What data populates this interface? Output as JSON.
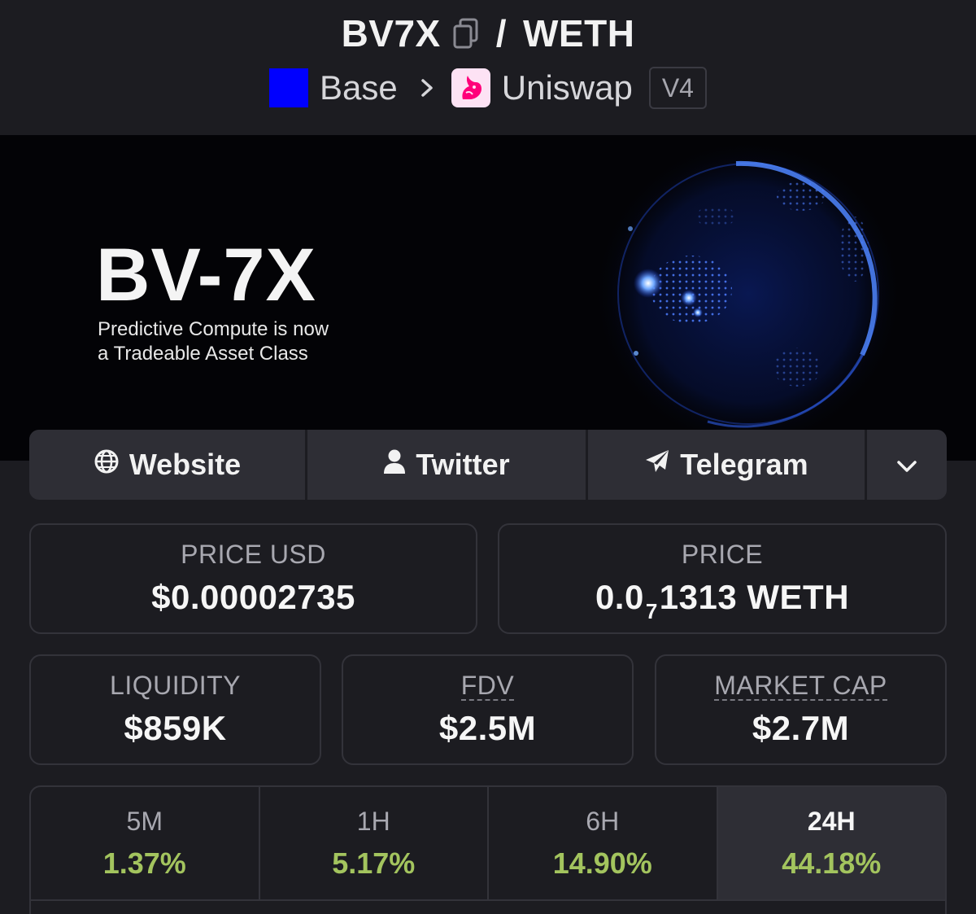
{
  "header": {
    "base_token": "BV7X",
    "separator": "/",
    "quote_token": "WETH",
    "chain": "Base",
    "dex": "Uniswap",
    "version": "V4"
  },
  "banner": {
    "title": "BV-7X",
    "subtitle_line1": "Predictive Compute is now",
    "subtitle_line2": "a Tradeable Asset Class"
  },
  "links": {
    "website": "Website",
    "twitter": "Twitter",
    "telegram": "Telegram"
  },
  "stats": {
    "price_usd_label": "PRICE USD",
    "price_usd_value": "$0.00002735",
    "price_label": "PRICE",
    "price_prefix": "0.0",
    "price_zeros": "7",
    "price_suffix": "1313 WETH",
    "liquidity_label": "LIQUIDITY",
    "liquidity_value": "$859K",
    "fdv_label": "FDV",
    "fdv_value": "$2.5M",
    "mcap_label": "MARKET CAP",
    "mcap_value": "$2.7M"
  },
  "timeframes": [
    {
      "label": "5M",
      "value": "1.37%"
    },
    {
      "label": "1H",
      "value": "5.17%"
    },
    {
      "label": "6H",
      "value": "14.90%"
    },
    {
      "label": "24H",
      "value": "44.18%"
    }
  ],
  "colors": {
    "background": "#1c1c21",
    "panel": "#2e2e35",
    "positive": "#a3c45e",
    "chain_blue": "#0000ff"
  }
}
